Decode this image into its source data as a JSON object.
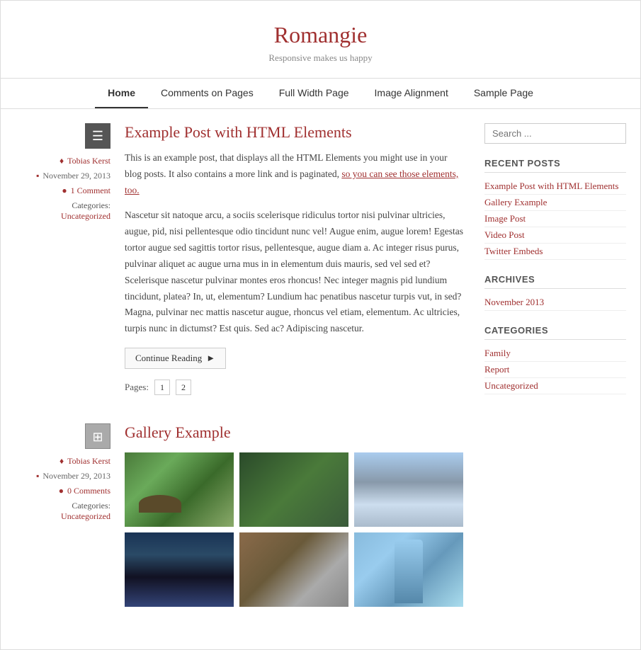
{
  "site": {
    "title": "Romangie",
    "tagline": "Responsive makes us happy"
  },
  "nav": {
    "items": [
      {
        "label": "Home",
        "active": true
      },
      {
        "label": "Comments on Pages",
        "active": false
      },
      {
        "label": "Full Width Page",
        "active": false
      },
      {
        "label": "Image Alignment",
        "active": false
      },
      {
        "label": "Sample Page",
        "active": false
      }
    ]
  },
  "posts": [
    {
      "id": "post-1",
      "icon": "≡",
      "title": "Example Post with HTML Elements",
      "author": "Tobias Kerst",
      "date": "November 29, 2013",
      "comments": "1 Comment",
      "categories": "Uncategorized",
      "excerpt_intro": "This is an example post, that displays all the HTML Elements you might use in your blog posts. It also contains a more link and is paginated, ",
      "excerpt_link": "so you can see those elements, too.",
      "body": "Nascetur sit natoque arcu, a sociis scelerisque ridiculus tortor nisi pulvinar ultricies, augue, pid, nisi pellentesque odio tincidunt nunc vel! Augue enim, augue lorem! Egestas tortor augue sed sagittis tortor risus, pellentesque, augue diam a. Ac integer risus purus, pulvinar aliquet ac augue urna mus in in elementum duis mauris, sed vel sed et? Scelerisque nascetur pulvinar montes eros rhoncus! Nec integer magnis pid lundium tincidunt, platea? In, ut, elementum? Lundium hac penatibus nascetur turpis vut, in sed? Magna, pulvinar nec mattis nascetur augue, rhoncus vel etiam, elementum. Ac ultricies, turpis nunc in dictumst? Est quis. Sed ac? Adipiscing nascetur.",
      "continue_btn": "Continue Reading",
      "pages_label": "Pages:",
      "pages": [
        "1",
        "2"
      ]
    },
    {
      "id": "post-2",
      "icon": "⊞",
      "title": "Gallery Example",
      "author": "Tobias Kerst",
      "date": "November 29, 2013",
      "comments": "0 Comments",
      "categories": "Uncategorized"
    }
  ],
  "sidebar": {
    "search_placeholder": "Search ...",
    "recent_posts_title": "RECENT POSTS",
    "recent_posts": [
      {
        "label": "Example Post with HTML Elements"
      },
      {
        "label": "Gallery Example"
      },
      {
        "label": "Image Post"
      },
      {
        "label": "Video Post"
      },
      {
        "label": "Twitter Embeds"
      }
    ],
    "archives_title": "ARCHIVES",
    "archives": [
      {
        "label": "November 2013"
      }
    ],
    "categories_title": "CATEGORIES",
    "categories": [
      {
        "label": "Family"
      },
      {
        "label": "Report"
      },
      {
        "label": "Uncategorized"
      }
    ]
  }
}
